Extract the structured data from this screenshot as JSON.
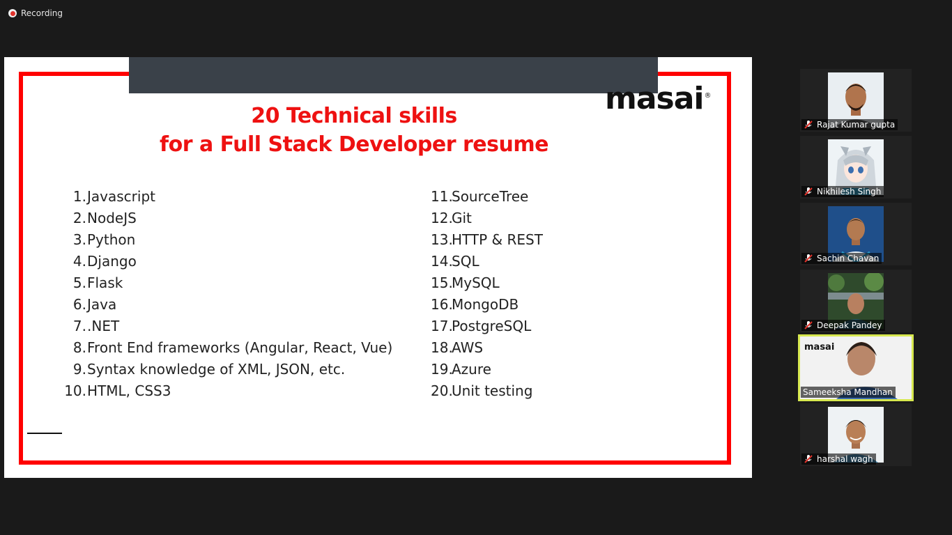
{
  "recording": {
    "label": "Recording"
  },
  "slide": {
    "logo": "masai",
    "logo_mark": "®",
    "title_line1": "20 Technical skills",
    "title_line2": "for a Full Stack Developer resume",
    "skills_left": [
      {
        "num": "1.",
        "text": "Javascript"
      },
      {
        "num": "2.",
        "text": "NodeJS"
      },
      {
        "num": "3.",
        "text": "Python"
      },
      {
        "num": "4.",
        "text": "Django"
      },
      {
        "num": "5.",
        "text": "Flask"
      },
      {
        "num": "6.",
        "text": "Java"
      },
      {
        "num": "7.",
        "text": ".NET"
      },
      {
        "num": "8.",
        "text": "Front End frameworks (Angular, React, Vue)"
      },
      {
        "num": "9.",
        "text": "Syntax knowledge of XML, JSON, etc."
      },
      {
        "num": "10.",
        "text": "HTML, CSS3"
      }
    ],
    "skills_right": [
      {
        "num": "11.",
        "text": "SourceTree"
      },
      {
        "num": "12.",
        "text": "Git"
      },
      {
        "num": "13.",
        "text": "HTTP & REST"
      },
      {
        "num": "14.",
        "text": "SQL"
      },
      {
        "num": "15.",
        "text": "MySQL"
      },
      {
        "num": "16.",
        "text": "MongoDB"
      },
      {
        "num": "17.",
        "text": "PostgreSQL"
      },
      {
        "num": "18.",
        "text": "AWS"
      },
      {
        "num": "19.",
        "text": "Azure"
      },
      {
        "num": "20.",
        "text": "Unit testing"
      }
    ]
  },
  "participants": [
    {
      "name": "Rajat Kumar gupta",
      "muted": true
    },
    {
      "name": "Nikhilesh Singh",
      "muted": true
    },
    {
      "name": "Sachin Chavan",
      "muted": true
    },
    {
      "name": "Deepak Pandey",
      "muted": true
    },
    {
      "name": "Sameeksha Mandhan",
      "muted": false,
      "active": true,
      "tile_logo": "masai"
    },
    {
      "name": "harshal wagh",
      "muted": true
    }
  ],
  "colors": {
    "accent_red": "#ff0000",
    "title_red": "#ee1111",
    "active_speaker_border": "#d7e84f",
    "background": "#1a1a1a"
  }
}
